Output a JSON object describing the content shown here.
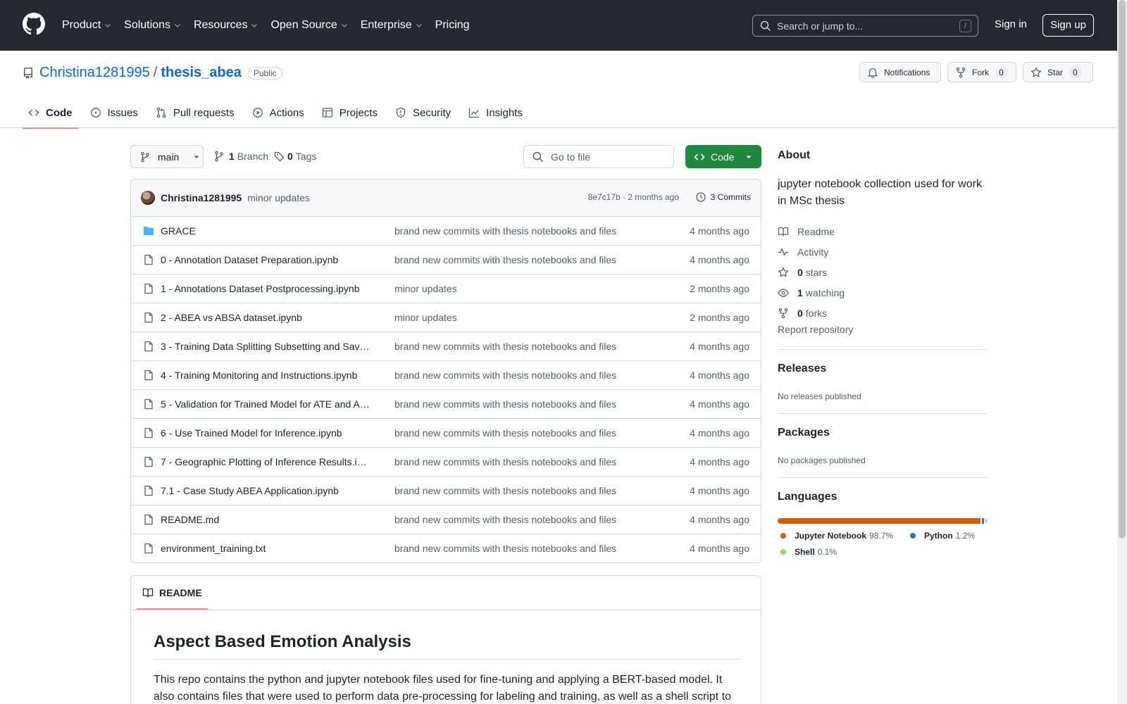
{
  "topnav": {
    "items": [
      {
        "label": "Product",
        "caret": true
      },
      {
        "label": "Solutions",
        "caret": true
      },
      {
        "label": "Resources",
        "caret": true
      },
      {
        "label": "Open Source",
        "caret": true
      },
      {
        "label": "Enterprise",
        "caret": true
      },
      {
        "label": "Pricing",
        "caret": false
      }
    ],
    "search_placeholder": "Search or jump to...",
    "search_shortcut": "/",
    "signin": "Sign in",
    "signup": "Sign up"
  },
  "repo": {
    "owner": "Christina1281995",
    "separator": "/",
    "name": "thesis_abea",
    "visibility": "Public",
    "notifications_label": "Notifications",
    "fork_label": "Fork",
    "fork_count": "0",
    "star_label": "Star",
    "star_count": "0"
  },
  "tabs": [
    {
      "label": "Code",
      "icon": "code-icon"
    },
    {
      "label": "Issues",
      "icon": "issue-icon"
    },
    {
      "label": "Pull requests",
      "icon": "pull-request-icon"
    },
    {
      "label": "Actions",
      "icon": "play-icon"
    },
    {
      "label": "Projects",
      "icon": "table-icon"
    },
    {
      "label": "Security",
      "icon": "shield-icon"
    },
    {
      "label": "Insights",
      "icon": "graph-icon"
    }
  ],
  "toolbar": {
    "branch": "main",
    "branch_count": "1",
    "branch_word": "Branch",
    "tag_count": "0",
    "tag_word": "Tags",
    "goto_file": "Go to file",
    "code_button": "Code"
  },
  "commit": {
    "author": "Christina1281995",
    "message": "minor updates",
    "sha_time": "8e7c17b · 2 months ago",
    "commits_label": "3 Commits"
  },
  "files": [
    {
      "name": "GRACE",
      "type": "folder",
      "message": "brand new commits with thesis notebooks and files",
      "age": "4 months ago"
    },
    {
      "name": "0 - Annotation Dataset Preparation.ipynb",
      "type": "file",
      "message": "brand new commits with thesis notebooks and files",
      "age": "4 months ago"
    },
    {
      "name": "1 - Annotations Dataset Postprocessing.ipynb",
      "type": "file",
      "message": "minor updates",
      "age": "2 months ago"
    },
    {
      "name": "2 - ABEA vs ABSA dataset.ipynb",
      "type": "file",
      "message": "minor updates",
      "age": "2 months ago"
    },
    {
      "name": "3 - Training Data Splitting Subsetting and Sav…",
      "type": "file",
      "message": "brand new commits with thesis notebooks and files",
      "age": "4 months ago"
    },
    {
      "name": "4 - Training Monitoring and Instructions.ipynb",
      "type": "file",
      "message": "brand new commits with thesis notebooks and files",
      "age": "4 months ago"
    },
    {
      "name": "5 - Validation for Trained Model for ATE and A…",
      "type": "file",
      "message": "brand new commits with thesis notebooks and files",
      "age": "4 months ago"
    },
    {
      "name": "6 - Use Trained Model for Inference.ipynb",
      "type": "file",
      "message": "brand new commits with thesis notebooks and files",
      "age": "4 months ago"
    },
    {
      "name": "7 - Geographic Plotting of Inference Results.i…",
      "type": "file",
      "message": "brand new commits with thesis notebooks and files",
      "age": "4 months ago"
    },
    {
      "name": "7.1 - Case Study ABEA Application.ipynb",
      "type": "file",
      "message": "brand new commits with thesis notebooks and files",
      "age": "4 months ago"
    },
    {
      "name": "README.md",
      "type": "file",
      "message": "brand new commits with thesis notebooks and files",
      "age": "4 months ago"
    },
    {
      "name": "environment_training.txt",
      "type": "file",
      "message": "brand new commits with thesis notebooks and files",
      "age": "4 months ago"
    }
  ],
  "readme": {
    "tab_label": "README",
    "heading": "Aspect Based Emotion Analysis",
    "body": "This repo contains the python and jupyter notebook files used for fine-tuning and applying a BERT-based model. It also contains files that were used to perform data pre-processing for labeling and training, as well as a shell script to"
  },
  "about": {
    "heading": "About",
    "description": "jupyter notebook collection used for work in MSc thesis",
    "items": [
      {
        "icon": "book-icon",
        "bold": "",
        "label": "Readme"
      },
      {
        "icon": "pulse-icon",
        "bold": "",
        "label": "Activity"
      },
      {
        "icon": "star-icon",
        "bold": "0",
        "label": "stars"
      },
      {
        "icon": "eye-icon",
        "bold": "1",
        "label": "watching"
      },
      {
        "icon": "fork-icon",
        "bold": "0",
        "label": "forks"
      }
    ],
    "report": "Report repository"
  },
  "releases": {
    "heading": "Releases",
    "sub": "No releases published"
  },
  "packages": {
    "heading": "Packages",
    "sub": "No packages published"
  },
  "languages": {
    "heading": "Languages",
    "items": [
      {
        "name": "Jupyter Notebook",
        "pct": "98.7%",
        "value": 98.7,
        "color": "#DA5B0B"
      },
      {
        "name": "Python",
        "pct": "1.2%",
        "value": 1.2,
        "color": "#3572A5"
      },
      {
        "name": "Shell",
        "pct": "0.1%",
        "value": 0.1,
        "color": "#89e051"
      }
    ]
  }
}
